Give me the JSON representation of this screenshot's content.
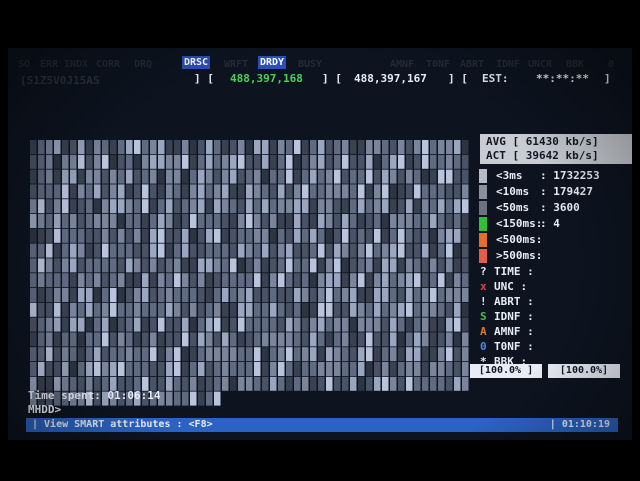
{
  "flags": {
    "items": [
      {
        "label": "SO",
        "active": false
      },
      {
        "label": "ERR",
        "active": false
      },
      {
        "label": "INDX",
        "active": false
      },
      {
        "label": "CORR",
        "active": false
      },
      {
        "label": "DRQ",
        "active": false
      },
      {
        "label": "DRSC",
        "active": true
      },
      {
        "label": "WRFT",
        "active": false
      },
      {
        "label": "DRDY",
        "active": true
      },
      {
        "label": "BUSY",
        "active": false
      },
      {
        "label": "AMNF",
        "active": false
      },
      {
        "label": "T0NF",
        "active": false
      },
      {
        "label": "ABRT",
        "active": false
      },
      {
        "label": "IDNF",
        "active": false
      },
      {
        "label": "UNCR",
        "active": false
      },
      {
        "label": "BBK",
        "active": false
      },
      {
        "label": "0",
        "active": false
      }
    ]
  },
  "serial": "[S1Z5V0J15AS",
  "lba": {
    "current": "488,397,168",
    "total": "488,397,167",
    "est_label": "EST:",
    "est_value": "**:**:**"
  },
  "speed": {
    "avg": "AVG [ 61430 kb/s]",
    "act": "ACT [ 39642 kb/s]"
  },
  "timings": [
    {
      "label": "<3ms",
      "value": "1732253",
      "color": "#b7bcc6"
    },
    {
      "label": "<10ms",
      "value": "179427",
      "color": "#8a909c"
    },
    {
      "label": "<50ms",
      "value": "3600",
      "color": "#6b7282"
    },
    {
      "label": "<150ms:",
      "value": "4",
      "color": "#2fbf3a"
    },
    {
      "label": "<500ms:",
      "value": "",
      "color": "#e0702c"
    },
    {
      "label": ">500ms:",
      "value": "",
      "color": "#e25d4a"
    }
  ],
  "errors": [
    {
      "symbol": "?",
      "label": "TIME",
      "color": "#e8ecf4"
    },
    {
      "symbol": "x",
      "label": "UNC",
      "color": "#e04040"
    },
    {
      "symbol": "!",
      "label": "ABRT",
      "color": "#e8ecf4"
    },
    {
      "symbol": "S",
      "label": "IDNF",
      "color": "#3fc14a"
    },
    {
      "symbol": "A",
      "label": "AMNF",
      "color": "#e07a2a"
    },
    {
      "symbol": "0",
      "label": "T0NF",
      "color": "#4a8ce0"
    },
    {
      "symbol": "*",
      "label": "BBK",
      "color": "#e8ecf4"
    }
  ],
  "progress": {
    "left": "[100.0% ]",
    "right": "[100.0%]"
  },
  "time_spent": "Time spent: 01:06:14",
  "prompt": "MHDD>",
  "status": {
    "hint": "| View SMART attributes : <F8>",
    "clock": "| 01:10:19"
  },
  "colors": {
    "accent": "#2b63c4",
    "flag_on": "#2b4fb4",
    "lba_current": "#4cd05a"
  }
}
